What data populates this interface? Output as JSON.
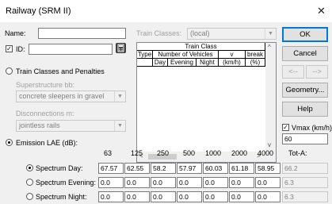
{
  "window": {
    "title": "Railway (SRM II)"
  },
  "name_field": {
    "label": "Name:",
    "value": ""
  },
  "id_field": {
    "label": "ID:",
    "checked": true,
    "value": "",
    "icon": "calculator-icon"
  },
  "train_classes": {
    "label": "Train Classes:",
    "value": "(local)"
  },
  "train_grid": {
    "group_header": "Train Class",
    "col_type": "Type",
    "col_vehicles": "Number of Vehicles",
    "col_v": "v",
    "col_brake": "break",
    "sub_day": "Day",
    "sub_evening": "Evening",
    "sub_night": "Night",
    "sub_v_unit": "(km/h)",
    "sub_brake_unit": "(%)"
  },
  "radio_train": {
    "label": "Train Classes and Penalties"
  },
  "superstructure": {
    "label": "Superstructure bb:",
    "value": "concrete sleepers in gravel"
  },
  "disconnections": {
    "label": "Disconnections m:",
    "value": "jointless rails"
  },
  "radio_emission": {
    "label": "Emission LAE (dB):"
  },
  "buttons": {
    "ok": "OK",
    "cancel": "Cancel",
    "prev": "<--",
    "next": "-->",
    "geometry": "Geometry...",
    "help": "Help"
  },
  "vmax": {
    "label": "Vmax (km/h)",
    "checked": true,
    "value": "60"
  },
  "freq_headers": [
    "63",
    "125",
    "250",
    "500",
    "1000",
    "2000",
    "4000"
  ],
  "total_header": "Tot-A:",
  "spectrum_rows": [
    {
      "label": "Spectrum Day:",
      "selected": true,
      "values": [
        "67.57",
        "62.55",
        "58.2",
        "57.97",
        "60.03",
        "61.18",
        "58.95"
      ],
      "total": "66.2"
    },
    {
      "label": "Spectrum Evening:",
      "selected": false,
      "values": [
        "0.0",
        "0.0",
        "0.0",
        "0.0",
        "0.0",
        "0.0",
        "0.0"
      ],
      "total": "6.3"
    },
    {
      "label": "Spectrum Night:",
      "selected": false,
      "values": [
        "0.0",
        "0.0",
        "0.0",
        "0.0",
        "0.0",
        "0.0",
        "0.0"
      ],
      "total": "6.3"
    }
  ],
  "colors": {
    "accent": "#0078d7",
    "dialog_bg": "#f0f0f0",
    "disabled_text": "#a0a0a0"
  }
}
